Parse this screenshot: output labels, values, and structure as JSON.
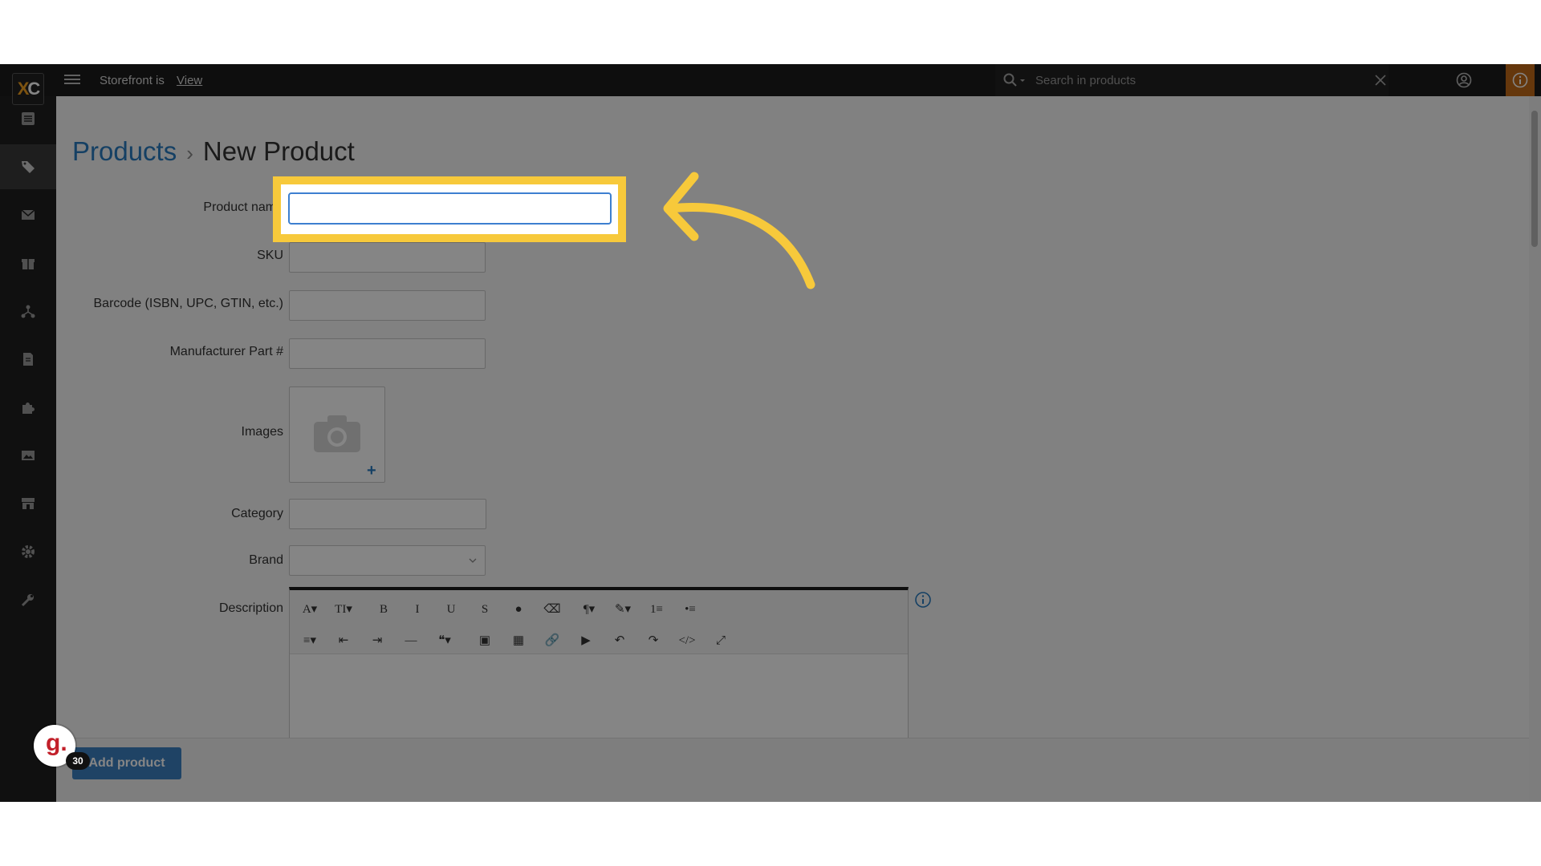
{
  "topbar": {
    "logo_left": "X",
    "logo_right": "C",
    "storefront_label": "Storefront is",
    "storefront_link": "View",
    "search_placeholder": "Search in products"
  },
  "sidebar": {
    "items": [
      {
        "icon": "list-icon"
      },
      {
        "icon": "tag-icon",
        "active": true
      },
      {
        "icon": "envelope-icon"
      },
      {
        "icon": "gift-icon"
      },
      {
        "icon": "network-icon"
      },
      {
        "icon": "document-icon"
      },
      {
        "icon": "puzzle-icon"
      },
      {
        "icon": "image-icon"
      },
      {
        "icon": "store-icon"
      },
      {
        "icon": "gear-icon"
      },
      {
        "icon": "wrench-icon"
      }
    ]
  },
  "breadcrumb": {
    "parent": "Products",
    "separator": "›",
    "current": "New Product"
  },
  "form": {
    "product_name_label": "Product name",
    "product_name_value": "",
    "sku_label": "SKU",
    "barcode_label": "Barcode (ISBN, UPC, GTIN, etc.)",
    "mpn_label": "Manufacturer Part #",
    "images_label": "Images",
    "add_image": "+",
    "category_label": "Category",
    "brand_label": "Brand",
    "description_label": "Description"
  },
  "editor": {
    "row1": [
      "A▾",
      "TI▾",
      "B",
      "I",
      "U",
      "S",
      "●",
      "⌫",
      "¶▾",
      "✎▾",
      "1≡",
      "•≡"
    ],
    "row2": [
      "≡▾",
      "⇤",
      "⇥",
      "—",
      "❝▾",
      "▣",
      "▦",
      "🔗",
      "▶",
      "↶",
      "↷",
      "</>",
      "⤢"
    ]
  },
  "actions": {
    "add_product": "Add product"
  },
  "grammarly": {
    "letter": "g.",
    "count": "30"
  },
  "colors": {
    "highlight": "#f7c93b",
    "link": "#2a7cc0",
    "topbar": "#1b1b1b",
    "info_button": "#c26a17"
  }
}
